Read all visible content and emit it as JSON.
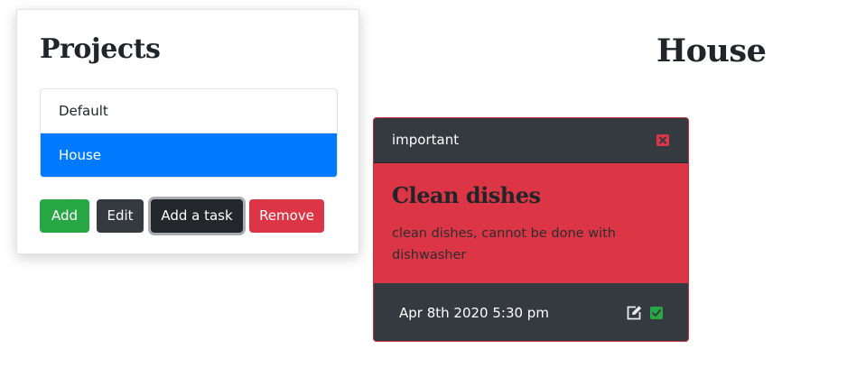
{
  "projects_panel": {
    "title": "Projects",
    "items": [
      {
        "label": "Default",
        "active": false
      },
      {
        "label": "House",
        "active": true
      }
    ],
    "buttons": {
      "add": "Add",
      "edit": "Edit",
      "add_task": "Add a task",
      "remove": "Remove"
    }
  },
  "project_view": {
    "heading": "House",
    "task": {
      "priority": "important",
      "title": "Clean dishes",
      "description": "clean dishes, cannot be done with dishwasher",
      "due": "Apr 8th 2020 5:30 pm",
      "icons": {
        "delete": "close-icon",
        "edit": "edit-icon",
        "complete": "check-icon"
      }
    }
  },
  "colors": {
    "primary": "#007bff",
    "success": "#28a745",
    "danger": "#dc3545",
    "dark": "#343a40"
  }
}
